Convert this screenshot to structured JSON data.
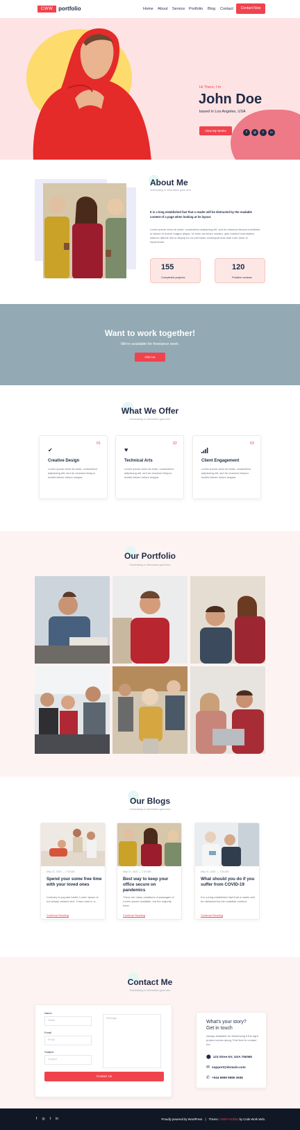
{
  "header": {
    "logo_box": "CWW",
    "logo_text": "portfolio",
    "nav": [
      "Home",
      "About",
      "Service",
      "Portfolio",
      "Blog",
      "Contact"
    ],
    "cta": "Contact Now"
  },
  "hero": {
    "greeting": "Hi There, I'm",
    "name": "John Doe",
    "location": "based in Los Angeles, USA",
    "button": "View My Works",
    "socials": [
      "f",
      "◎",
      "t",
      "in"
    ]
  },
  "about": {
    "title": "About Me",
    "subtitle": "Subheading or information goes here",
    "lead": "It is a long established fact that a reader will be distracted by the readable content of a page when looking at its layout.",
    "body": "Lorem ipsum dolor sit amet, consectetur adipiscing elit, sed do eiusmod tempor incididunt ut labore et dolore magna aliqua. Ut enim ad minim veniam, quis nostrud exercitation ullamco laboris nisi ut aliquip ex ea commodo consequat duis aute irure dolor in reprehende.",
    "stats": [
      {
        "value": "155",
        "label": "Completed projects"
      },
      {
        "value": "120",
        "label": "Positive reviews"
      }
    ]
  },
  "cta_band": {
    "title": "Want to work together!",
    "subtitle": "We're available for freelance work.",
    "button": "Hire Us"
  },
  "offer": {
    "title": "What We Offer",
    "subtitle": "Subheading or information goes here",
    "cards": [
      {
        "num": "01",
        "icon": "check-icon",
        "title": "Creative Design",
        "text": "Lorem ipsum dolor sit amet, consectetur adipiscing elit, sed do eiusmod tempor incidid labore dolore magna."
      },
      {
        "num": "02",
        "icon": "heart-icon",
        "title": "Technical Arts",
        "text": "Lorem ipsum dolor sit amet, consectetur adipiscing elit, sed do eiusmod tempor incidid labore dolore magna."
      },
      {
        "num": "03",
        "icon": "signal-bars-icon",
        "title": "Client Engagement",
        "text": "Lorem ipsum dolor sit amet, consectetur adipiscing elit, sed do eiusmod tempor incidid labore dolore magna."
      }
    ]
  },
  "portfolio": {
    "title": "Our Portfolio",
    "subtitle": "Subheading or information goes here"
  },
  "blogs": {
    "title": "Our Blogs",
    "subtitle": "Subheading or information goes here",
    "posts": [
      {
        "date": "May 21, 2021 — 7:30 AM",
        "title": "Spend your some free time with your loved ones",
        "text": "Contrary to popular belief, Lorem Ipsum is not simply random text. It has roots in a.",
        "link": "Continue Reading"
      },
      {
        "date": "May 21, 2021 — 7:30 AM",
        "title": "Best way to keep your office secure on pandemics",
        "text": "There are many variations of passages of Lorem Ipsum available, but the majority have.",
        "link": "Continue Reading"
      },
      {
        "date": "May 21, 2021 — 7:30 AM",
        "title": "What should you do if you suffer from COVID-19",
        "text": "It is a long established fact that a reader will be distracted by the readable content.",
        "link": "Continue Reading"
      }
    ]
  },
  "contact": {
    "title": "Contact Me",
    "subtitle": "Subheading or information goes here",
    "labels": {
      "name": "Name",
      "email": "Email",
      "subject": "Subject"
    },
    "placeholders": {
      "name": "Name",
      "email": "Email",
      "subject": "Subject",
      "message": "Message"
    },
    "submit": "Contact Us",
    "info_title_1": "What's your story?",
    "info_title_2": "Get in touch",
    "info_text": "Always available for freelancing if the right project comes along, Feel free to contact me.",
    "address": "123 Stree NY, USA 750065",
    "email": "support@domain.com",
    "phone": "+044 9696 9696 3636"
  },
  "footer": {
    "socials": [
      "f",
      "◎",
      "t",
      "in"
    ],
    "credit_prefix": "Proudly powered by WordPress",
    "sep": "|",
    "theme_label": "Theme:",
    "theme_name": "CWW Portfolio",
    "by": "by Code Work Web."
  },
  "colors": {
    "accent": "#f0434d",
    "navy": "#1f2a44",
    "hero_bg": "#fde3e3",
    "band": "#93a9b3"
  }
}
